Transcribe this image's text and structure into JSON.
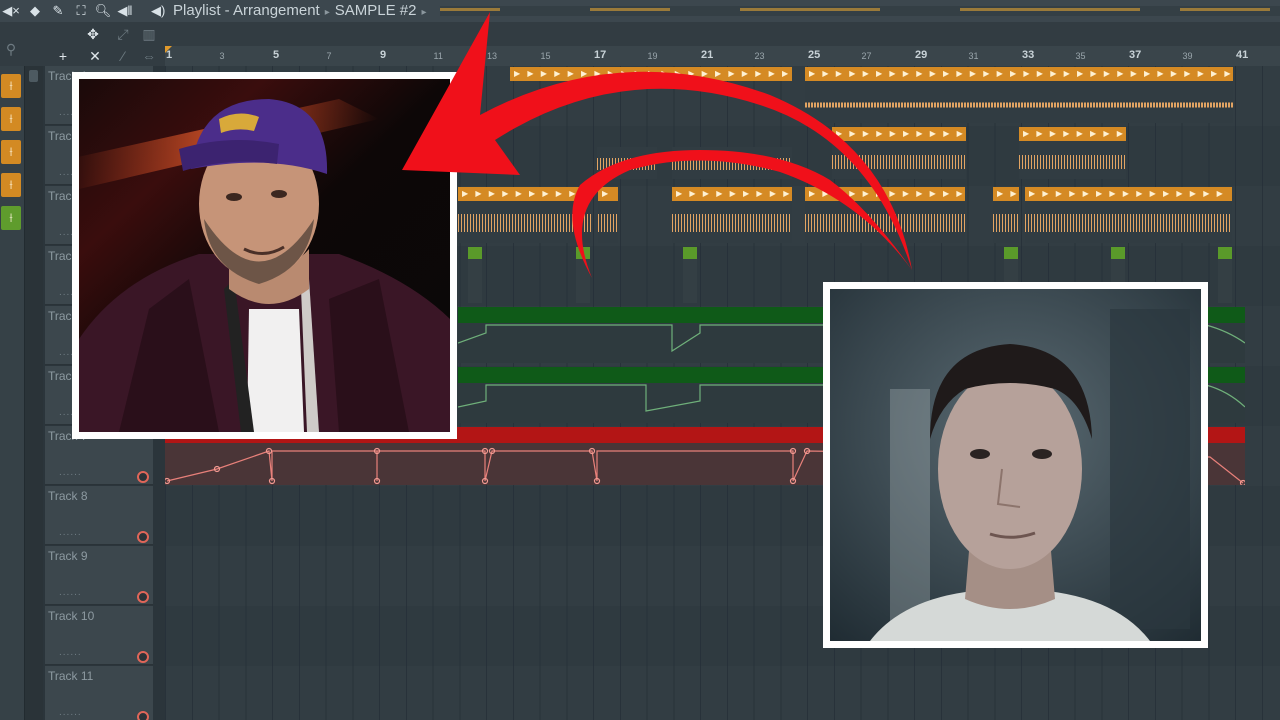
{
  "titlebar": {
    "breadcrumb_window": "Playlist - Arrangement",
    "breadcrumb_pattern": "SAMPLE #2",
    "sep1": "▸",
    "sep2": "▸"
  },
  "toolbar": {
    "icons": [
      "mute-icon",
      "pan-icon",
      "draw-icon",
      "select-icon",
      "zoom-icon",
      "speaker-icon"
    ],
    "add_label": "+",
    "cut_label": "✕"
  },
  "ruler": {
    "bars": [
      "1",
      "3",
      "5",
      "7",
      "9",
      "11",
      "13",
      "15",
      "17",
      "19",
      "21",
      "23",
      "25",
      "27",
      "29",
      "31",
      "33",
      "35",
      "37",
      "39",
      "41"
    ],
    "major_bars": [
      "5",
      "9",
      "17",
      "21",
      "25",
      "29",
      "33",
      "37",
      "41"
    ]
  },
  "tracks": [
    {
      "name": "Track 1"
    },
    {
      "name": "Track 2"
    },
    {
      "name": "Track 3"
    },
    {
      "name": "Track 4"
    },
    {
      "name": "Track 5"
    },
    {
      "name": "Track 6"
    },
    {
      "name": "Track 7"
    },
    {
      "name": "Track 8"
    },
    {
      "name": "Track 9"
    },
    {
      "name": "Track 10"
    },
    {
      "name": "Track 11"
    }
  ],
  "track_dots": "......",
  "colors": {
    "audio_clip": "#d58a24",
    "automation_green": "#0f5a18",
    "automation_red": "#b31515",
    "arrow": "#f0101a",
    "pattern_green": "#5f9c2d"
  },
  "overlays": {
    "left_photo": "photo of man wearing purple cap",
    "right_photo": "photo of young man",
    "arrow": "red curved arrow pointing left"
  }
}
